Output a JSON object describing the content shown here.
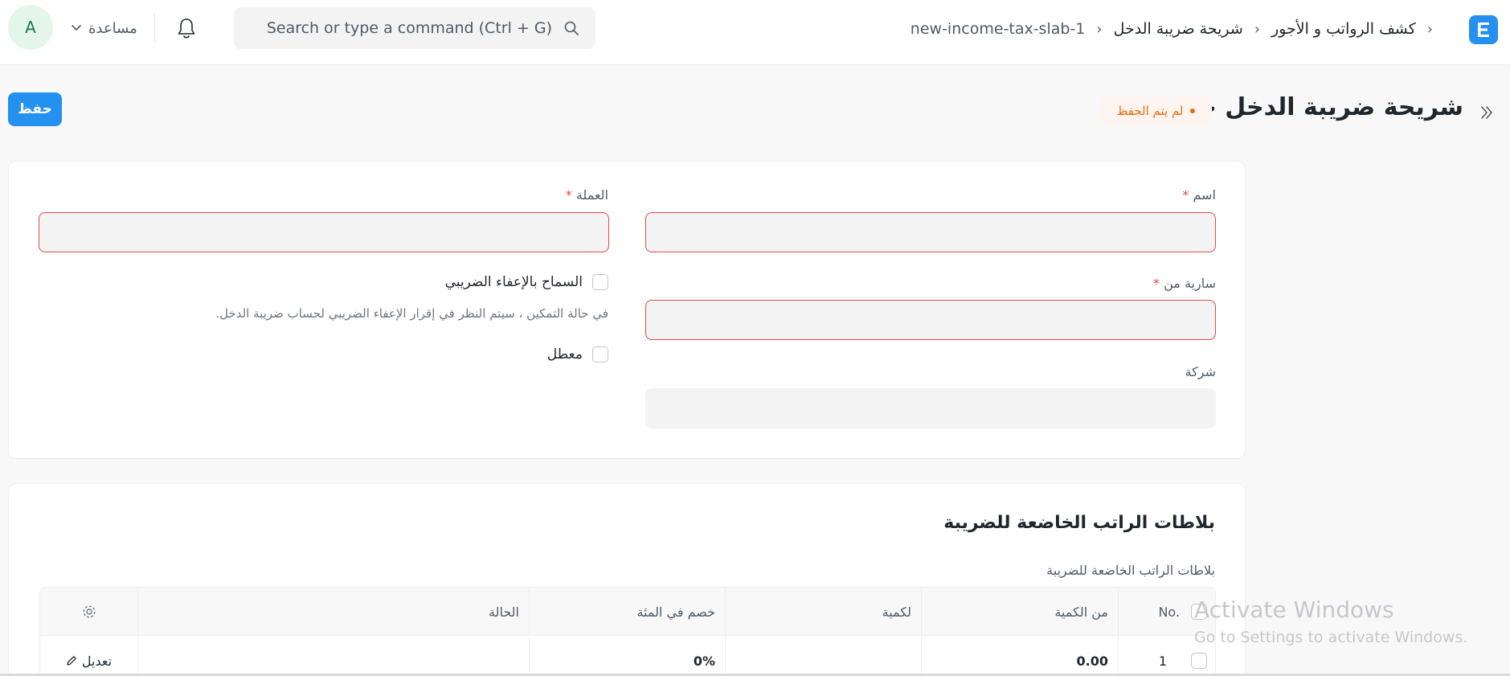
{
  "navbar": {
    "logo_letter": "E",
    "breadcrumbs": [
      "كشف الرواتب و الأجور",
      "شريحة ضريبة الدخل",
      "new-income-tax-slab-1"
    ],
    "search_placeholder": "Search or type a command (Ctrl + G)",
    "help_label": "مساعدة",
    "avatar_letter": "A"
  },
  "page": {
    "title": "شريحة ضريبة الدخل جديد",
    "status": "لم يتم الحفظ",
    "save_label": "حفظ"
  },
  "form": {
    "name_label": "اسم",
    "currency_label": "العملة",
    "effective_from_label": "سارية من",
    "company_label": "شركة",
    "allow_exemption_label": "السماح بالإعفاء الضريبي",
    "allow_exemption_help": "في حالة التمكين ، سيتم النظر في إقرار الإعفاء الضريبي لحساب ضريبة الدخل.",
    "disabled_label": "معطل",
    "required_mark": "*"
  },
  "slabs": {
    "section_title": "بلاطات الراتب الخاضعة للضريبة",
    "table_label": "بلاطات الراتب الخاضعة للضريبة",
    "columns": {
      "no": "No.",
      "from_amount": "من الكمية",
      "to_amount": "لكمية",
      "percent_deduction": "خصم في المئة",
      "condition": "الحالة"
    },
    "rows": [
      {
        "no": "1",
        "from_amount": "0.00",
        "to_amount": "",
        "percent_deduction": "0%",
        "condition": "",
        "edit_label": "تعديل"
      }
    ]
  },
  "watermark": {
    "title": "Activate Windows",
    "subtitle": "Go to Settings to activate Windows."
  }
}
